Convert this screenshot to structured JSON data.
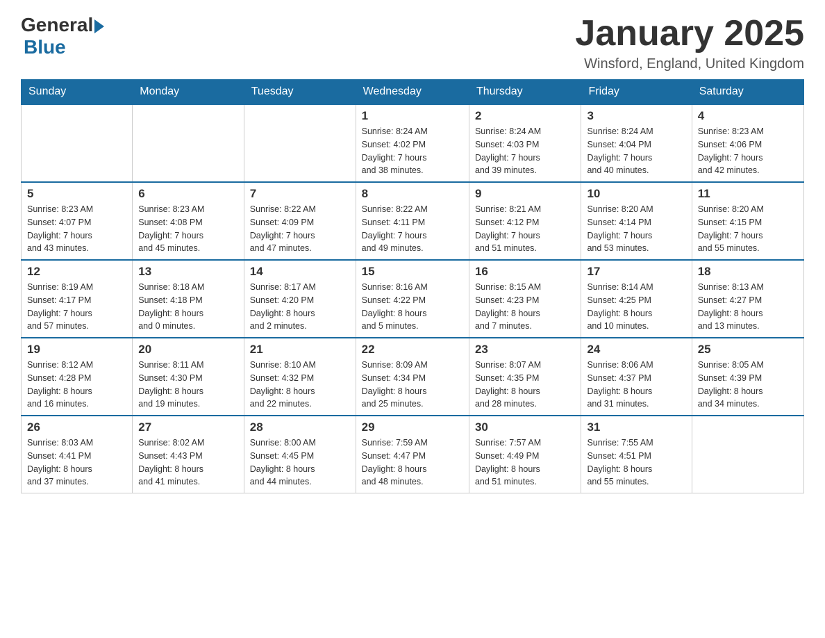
{
  "header": {
    "logo_general": "General",
    "logo_blue": "Blue",
    "month_title": "January 2025",
    "location": "Winsford, England, United Kingdom"
  },
  "weekdays": [
    "Sunday",
    "Monday",
    "Tuesday",
    "Wednesday",
    "Thursday",
    "Friday",
    "Saturday"
  ],
  "weeks": [
    [
      {
        "day": "",
        "info": ""
      },
      {
        "day": "",
        "info": ""
      },
      {
        "day": "",
        "info": ""
      },
      {
        "day": "1",
        "info": "Sunrise: 8:24 AM\nSunset: 4:02 PM\nDaylight: 7 hours\nand 38 minutes."
      },
      {
        "day": "2",
        "info": "Sunrise: 8:24 AM\nSunset: 4:03 PM\nDaylight: 7 hours\nand 39 minutes."
      },
      {
        "day": "3",
        "info": "Sunrise: 8:24 AM\nSunset: 4:04 PM\nDaylight: 7 hours\nand 40 minutes."
      },
      {
        "day": "4",
        "info": "Sunrise: 8:23 AM\nSunset: 4:06 PM\nDaylight: 7 hours\nand 42 minutes."
      }
    ],
    [
      {
        "day": "5",
        "info": "Sunrise: 8:23 AM\nSunset: 4:07 PM\nDaylight: 7 hours\nand 43 minutes."
      },
      {
        "day": "6",
        "info": "Sunrise: 8:23 AM\nSunset: 4:08 PM\nDaylight: 7 hours\nand 45 minutes."
      },
      {
        "day": "7",
        "info": "Sunrise: 8:22 AM\nSunset: 4:09 PM\nDaylight: 7 hours\nand 47 minutes."
      },
      {
        "day": "8",
        "info": "Sunrise: 8:22 AM\nSunset: 4:11 PM\nDaylight: 7 hours\nand 49 minutes."
      },
      {
        "day": "9",
        "info": "Sunrise: 8:21 AM\nSunset: 4:12 PM\nDaylight: 7 hours\nand 51 minutes."
      },
      {
        "day": "10",
        "info": "Sunrise: 8:20 AM\nSunset: 4:14 PM\nDaylight: 7 hours\nand 53 minutes."
      },
      {
        "day": "11",
        "info": "Sunrise: 8:20 AM\nSunset: 4:15 PM\nDaylight: 7 hours\nand 55 minutes."
      }
    ],
    [
      {
        "day": "12",
        "info": "Sunrise: 8:19 AM\nSunset: 4:17 PM\nDaylight: 7 hours\nand 57 minutes."
      },
      {
        "day": "13",
        "info": "Sunrise: 8:18 AM\nSunset: 4:18 PM\nDaylight: 8 hours\nand 0 minutes."
      },
      {
        "day": "14",
        "info": "Sunrise: 8:17 AM\nSunset: 4:20 PM\nDaylight: 8 hours\nand 2 minutes."
      },
      {
        "day": "15",
        "info": "Sunrise: 8:16 AM\nSunset: 4:22 PM\nDaylight: 8 hours\nand 5 minutes."
      },
      {
        "day": "16",
        "info": "Sunrise: 8:15 AM\nSunset: 4:23 PM\nDaylight: 8 hours\nand 7 minutes."
      },
      {
        "day": "17",
        "info": "Sunrise: 8:14 AM\nSunset: 4:25 PM\nDaylight: 8 hours\nand 10 minutes."
      },
      {
        "day": "18",
        "info": "Sunrise: 8:13 AM\nSunset: 4:27 PM\nDaylight: 8 hours\nand 13 minutes."
      }
    ],
    [
      {
        "day": "19",
        "info": "Sunrise: 8:12 AM\nSunset: 4:28 PM\nDaylight: 8 hours\nand 16 minutes."
      },
      {
        "day": "20",
        "info": "Sunrise: 8:11 AM\nSunset: 4:30 PM\nDaylight: 8 hours\nand 19 minutes."
      },
      {
        "day": "21",
        "info": "Sunrise: 8:10 AM\nSunset: 4:32 PM\nDaylight: 8 hours\nand 22 minutes."
      },
      {
        "day": "22",
        "info": "Sunrise: 8:09 AM\nSunset: 4:34 PM\nDaylight: 8 hours\nand 25 minutes."
      },
      {
        "day": "23",
        "info": "Sunrise: 8:07 AM\nSunset: 4:35 PM\nDaylight: 8 hours\nand 28 minutes."
      },
      {
        "day": "24",
        "info": "Sunrise: 8:06 AM\nSunset: 4:37 PM\nDaylight: 8 hours\nand 31 minutes."
      },
      {
        "day": "25",
        "info": "Sunrise: 8:05 AM\nSunset: 4:39 PM\nDaylight: 8 hours\nand 34 minutes."
      }
    ],
    [
      {
        "day": "26",
        "info": "Sunrise: 8:03 AM\nSunset: 4:41 PM\nDaylight: 8 hours\nand 37 minutes."
      },
      {
        "day": "27",
        "info": "Sunrise: 8:02 AM\nSunset: 4:43 PM\nDaylight: 8 hours\nand 41 minutes."
      },
      {
        "day": "28",
        "info": "Sunrise: 8:00 AM\nSunset: 4:45 PM\nDaylight: 8 hours\nand 44 minutes."
      },
      {
        "day": "29",
        "info": "Sunrise: 7:59 AM\nSunset: 4:47 PM\nDaylight: 8 hours\nand 48 minutes."
      },
      {
        "day": "30",
        "info": "Sunrise: 7:57 AM\nSunset: 4:49 PM\nDaylight: 8 hours\nand 51 minutes."
      },
      {
        "day": "31",
        "info": "Sunrise: 7:55 AM\nSunset: 4:51 PM\nDaylight: 8 hours\nand 55 minutes."
      },
      {
        "day": "",
        "info": ""
      }
    ]
  ]
}
